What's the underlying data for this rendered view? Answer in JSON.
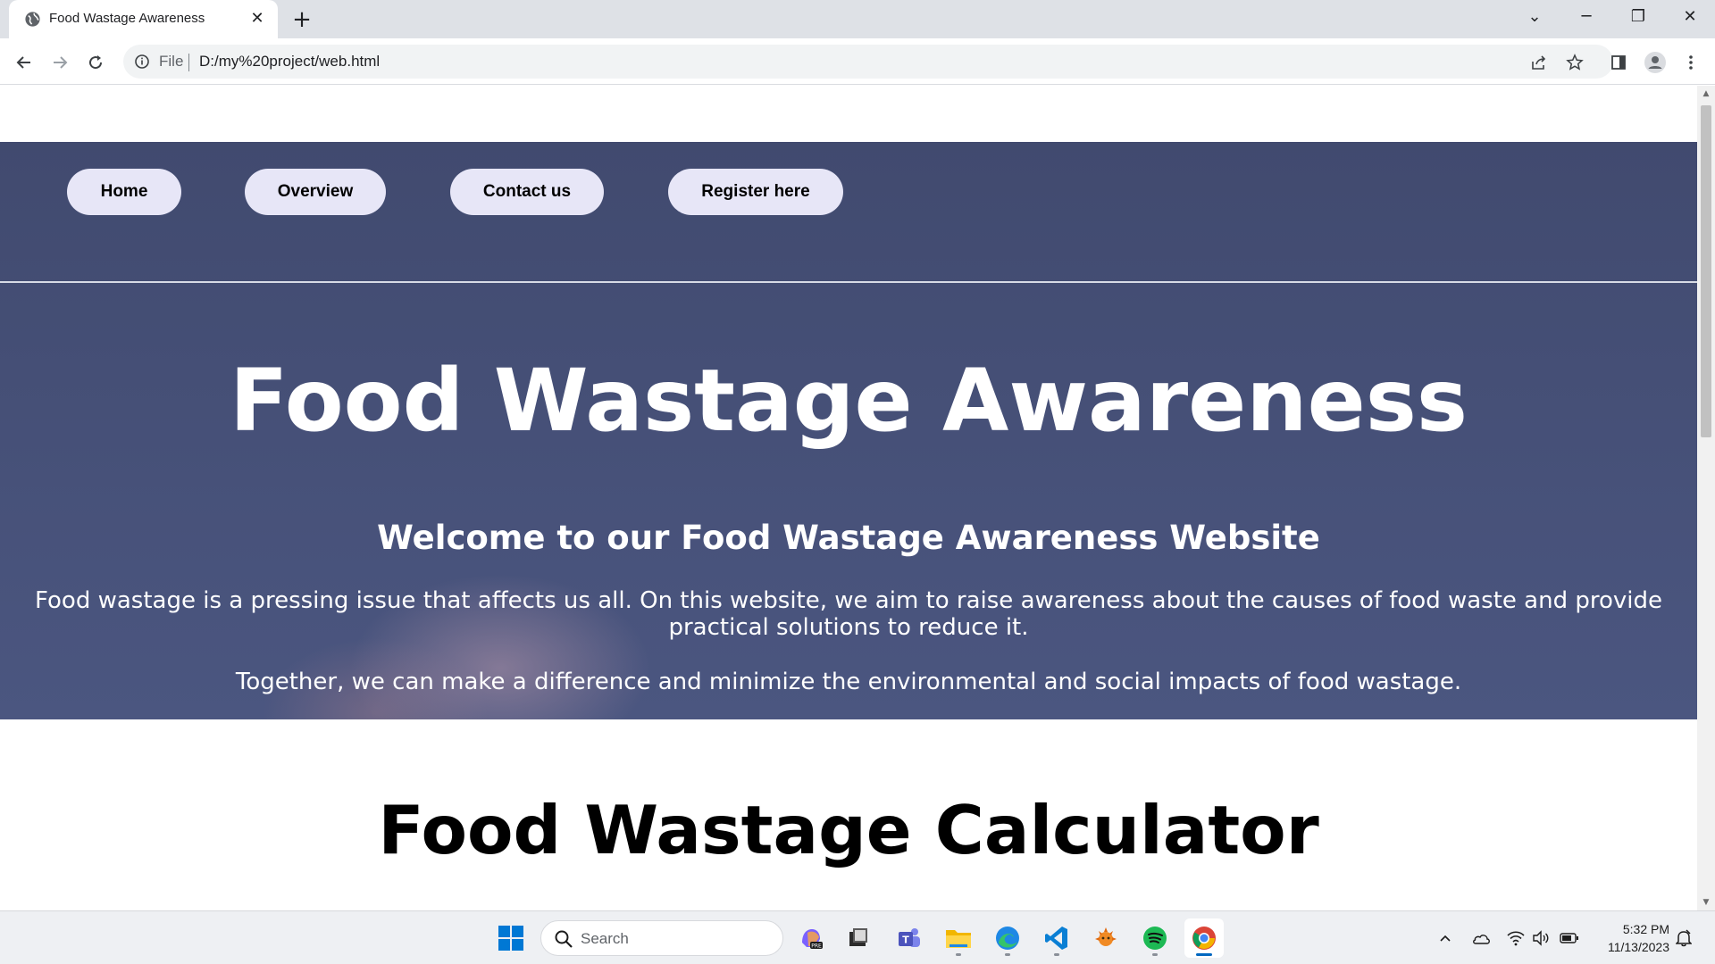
{
  "browser": {
    "tab": {
      "title": "Food Wastage Awareness",
      "favicon": "globe-icon"
    },
    "address": {
      "scheme": "File",
      "url": "D:/my%20project/web.html"
    },
    "icons": [
      "back-icon",
      "forward-icon",
      "reload-icon",
      "info-icon",
      "share-icon",
      "star-icon",
      "side-panel-icon",
      "profile-icon",
      "menu-icon"
    ]
  },
  "page": {
    "nav": [
      "Home",
      "Overview",
      "Contact us",
      "Register here"
    ],
    "hero": {
      "title": "Food Wastage Awareness",
      "subtitle": "Welcome to our Food Wastage Awareness Website",
      "paragraph1": "Food wastage is a pressing issue that affects us all. On this website, we aim to raise awareness about the causes of food waste and provide practical solutions to reduce it.",
      "paragraph2": "Together, we can make a difference and minimize the environmental and social impacts of food wastage."
    },
    "calculator_title": "Food Wastage Calculator"
  },
  "taskbar": {
    "search_placeholder": "Search",
    "apps": [
      "windows-start-icon",
      "copilot-icon",
      "file-viewer-icon",
      "teams-icon",
      "file-explorer-icon",
      "edge-icon",
      "vscode-icon",
      "app-icon",
      "spotify-icon",
      "chrome-icon"
    ],
    "clock": {
      "time": "5:32 PM",
      "date": "11/13/2023"
    }
  },
  "colors": {
    "hero_background": "#454f76",
    "nav_pill": "#e7e6f7",
    "taskbar": "#eef0f3"
  }
}
